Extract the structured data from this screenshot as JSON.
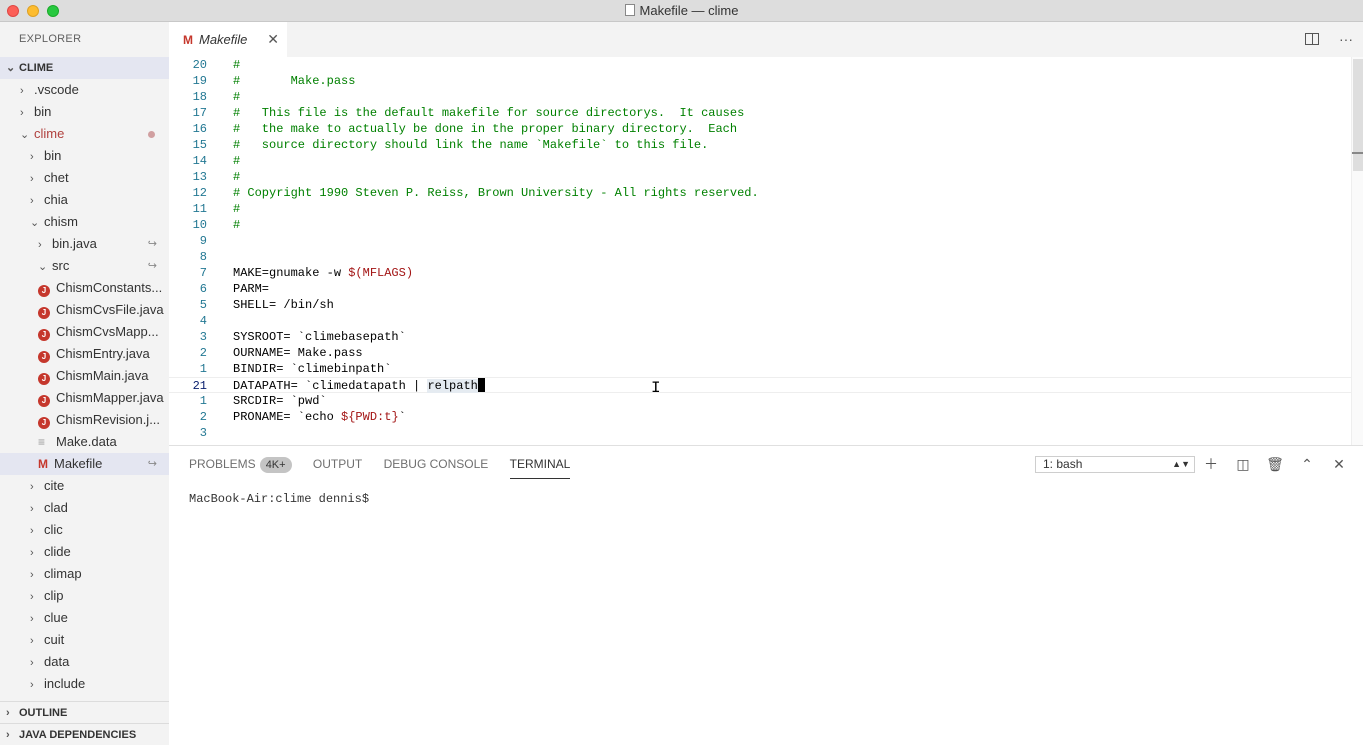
{
  "window": {
    "title": "Makefile — clime"
  },
  "sidebar": {
    "header": "EXPLORER",
    "root": "CLIME",
    "items": [
      {
        "label": ".vscode",
        "indent": 0,
        "kind": "folder-closed"
      },
      {
        "label": "bin",
        "indent": 0,
        "kind": "folder-closed"
      },
      {
        "label": "clime",
        "indent": 0,
        "kind": "folder-open",
        "modified": true
      },
      {
        "label": "bin",
        "indent": 1,
        "kind": "folder-closed"
      },
      {
        "label": "chet",
        "indent": 1,
        "kind": "folder-closed"
      },
      {
        "label": "chia",
        "indent": 1,
        "kind": "folder-closed"
      },
      {
        "label": "chism",
        "indent": 1,
        "kind": "folder-open"
      },
      {
        "label": "bin.java",
        "indent": 2,
        "kind": "folder-closed",
        "symlink": true
      },
      {
        "label": "src",
        "indent": 2,
        "kind": "folder-open",
        "symlink": true
      },
      {
        "label": "ChismConstants...",
        "indent": 2,
        "kind": "java"
      },
      {
        "label": "ChismCvsFile.java",
        "indent": 2,
        "kind": "java"
      },
      {
        "label": "ChismCvsMapp...",
        "indent": 2,
        "kind": "java"
      },
      {
        "label": "ChismEntry.java",
        "indent": 2,
        "kind": "java"
      },
      {
        "label": "ChismMain.java",
        "indent": 2,
        "kind": "java"
      },
      {
        "label": "ChismMapper.java",
        "indent": 2,
        "kind": "java"
      },
      {
        "label": "ChismRevision.j...",
        "indent": 2,
        "kind": "java"
      },
      {
        "label": "Make.data",
        "indent": 2,
        "kind": "text"
      },
      {
        "label": "Makefile",
        "indent": 2,
        "kind": "makefile",
        "symlink": true,
        "selected": true
      },
      {
        "label": "cite",
        "indent": 1,
        "kind": "folder-closed"
      },
      {
        "label": "clad",
        "indent": 1,
        "kind": "folder-closed"
      },
      {
        "label": "clic",
        "indent": 1,
        "kind": "folder-closed"
      },
      {
        "label": "clide",
        "indent": 1,
        "kind": "folder-closed"
      },
      {
        "label": "climap",
        "indent": 1,
        "kind": "folder-closed"
      },
      {
        "label": "clip",
        "indent": 1,
        "kind": "folder-closed"
      },
      {
        "label": "clue",
        "indent": 1,
        "kind": "folder-closed"
      },
      {
        "label": "cuit",
        "indent": 1,
        "kind": "folder-closed"
      },
      {
        "label": "data",
        "indent": 1,
        "kind": "folder-closed"
      },
      {
        "label": "include",
        "indent": 1,
        "kind": "folder-closed"
      }
    ],
    "outline": "OUTLINE",
    "java_deps": "JAVA DEPENDENCIES"
  },
  "editor": {
    "tab_label": "Makefile",
    "lines": [
      {
        "n": "20",
        "text": "#"
      },
      {
        "n": "19",
        "text": "#       Make.pass"
      },
      {
        "n": "18",
        "text": "#"
      },
      {
        "n": "17",
        "text": "#   This file is the default makefile for source directorys.  It causes"
      },
      {
        "n": "16",
        "text": "#   the make to actually be done in the proper binary directory.  Each"
      },
      {
        "n": "15",
        "text": "#   source directory should link the name `Makefile` to this file."
      },
      {
        "n": "14",
        "text": "#"
      },
      {
        "n": "13",
        "text": "#"
      },
      {
        "n": "12",
        "text": "# Copyright 1990 Steven P. Reiss, Brown University - All rights reserved."
      },
      {
        "n": "11",
        "text": "#"
      },
      {
        "n": "10",
        "text": "#"
      },
      {
        "n": "9",
        "text": ""
      },
      {
        "n": "8",
        "text": ""
      },
      {
        "n": "7",
        "text": "MAKE=gnumake -w ",
        "var": "$(MFLAGS)"
      },
      {
        "n": "6",
        "text": "PARM="
      },
      {
        "n": "5",
        "text": "SHELL= /bin/sh"
      },
      {
        "n": "4",
        "text": ""
      },
      {
        "n": "3",
        "text": "SYSROOT= `climebasepath`"
      },
      {
        "n": "2",
        "text": "OURNAME= Make.pass"
      },
      {
        "n": "1",
        "text": "BINDIR= `climebinpath`"
      },
      {
        "n": "21",
        "text": "DATAPATH= `climedatapath | ",
        "hl": "relpath",
        "current": true
      },
      {
        "n": "1",
        "text": "SRCDIR= `pwd`"
      },
      {
        "n": "2",
        "text": "PRONAME= `echo ",
        "var": "${PWD:t}",
        "tail": "`"
      },
      {
        "n": "3",
        "text": ""
      }
    ]
  },
  "panel": {
    "tabs": {
      "problems": "PROBLEMS",
      "problems_badge": "4K+",
      "output": "OUTPUT",
      "debug": "DEBUG CONSOLE",
      "terminal": "TERMINAL"
    },
    "terminal_select": "1: bash",
    "prompt": "MacBook-Air:clime dennis$"
  }
}
